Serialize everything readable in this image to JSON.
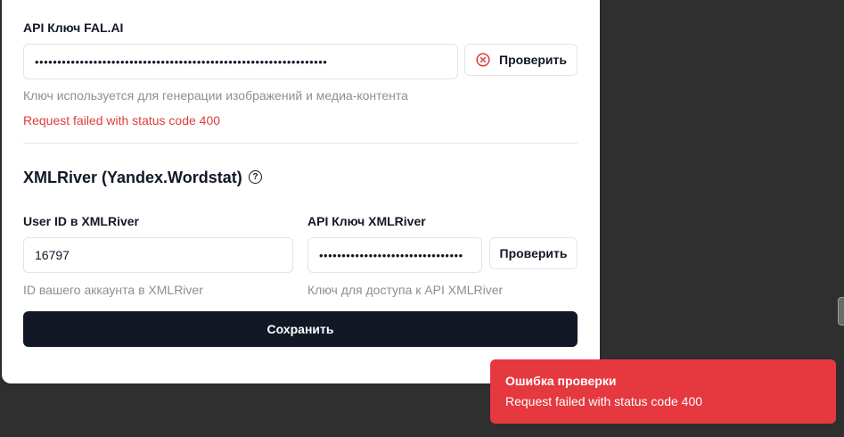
{
  "fal": {
    "label": "API Ключ FAL.AI",
    "value": "•••••••••••••••••••••••••••••••••••••••••••••••••••••••••••••••••",
    "check_label": "Проверить",
    "hint": "Ключ используется для генерации изображений и медиа-контента",
    "error": "Request failed with status code 400"
  },
  "xmlriver": {
    "title": "XMLRiver (Yandex.Wordstat)",
    "user_id_label": "User ID в XMLRiver",
    "user_id_value": "16797",
    "user_id_hint": "ID вашего аккаунта в XMLRiver",
    "api_label": "API Ключ XMLRiver",
    "api_value": "••••••••••••••••••••••••••••••••",
    "check_label": "Проверить",
    "api_hint": "Ключ для доступа к API XMLRiver"
  },
  "save_label": "Сохранить",
  "toast": {
    "title": "Ошибка проверки",
    "message": "Request failed with status code 400"
  },
  "colors": {
    "error": "#e03c3c",
    "toast_bg": "#e5393f",
    "primary_button": "#121826",
    "backdrop": "#2f2f2f"
  }
}
